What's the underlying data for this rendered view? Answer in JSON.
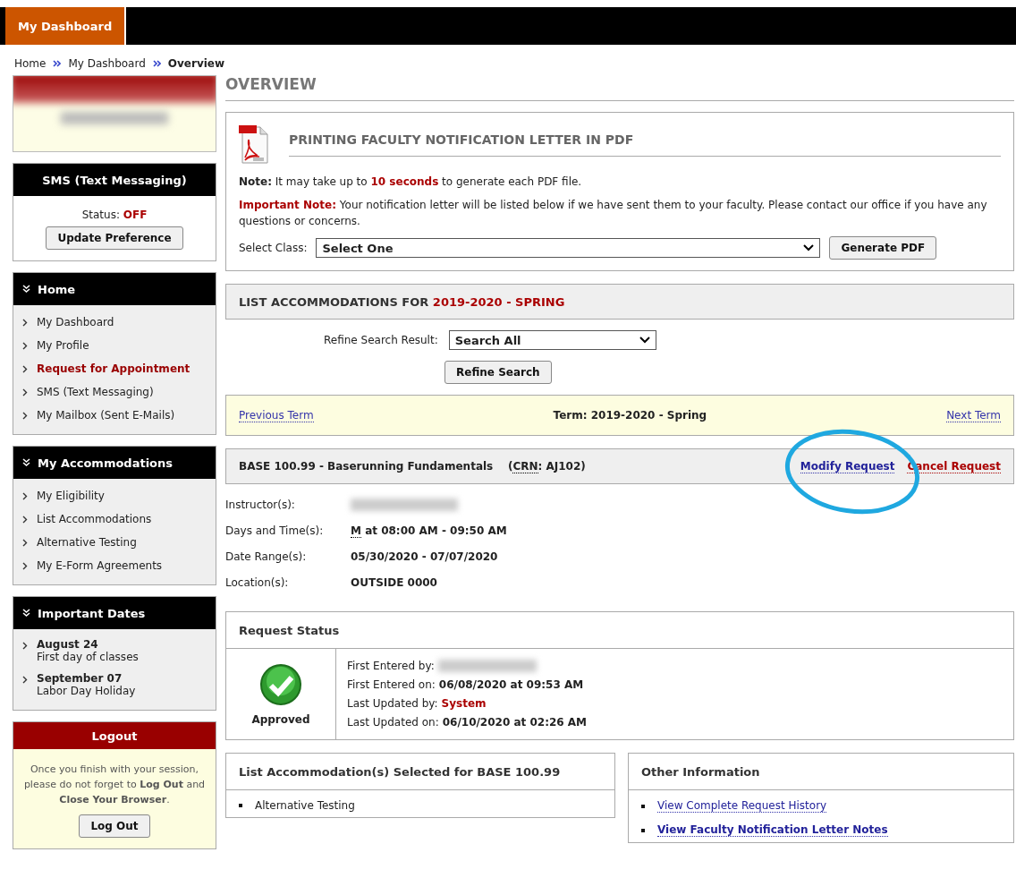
{
  "top_tabs": [
    {
      "label": "My Dashboard",
      "selected": true
    }
  ],
  "breadcrumb": [
    {
      "label": "Home",
      "current": false
    },
    {
      "label": "My Dashboard",
      "current": false
    },
    {
      "label": "Overview",
      "current": true
    }
  ],
  "sms_box": {
    "title": "SMS (Text Messaging)",
    "status_label": "Status:",
    "status_value": "OFF",
    "button": "Update Preference"
  },
  "nav_sections": [
    {
      "title": "Home",
      "items": [
        {
          "label": "My Dashboard",
          "selected": false
        },
        {
          "label": "My Profile",
          "selected": false
        },
        {
          "label": "Request for Appointment",
          "selected": true
        },
        {
          "label": "SMS (Text Messaging)",
          "selected": false
        },
        {
          "label": "My Mailbox (Sent E-Mails)",
          "selected": false
        }
      ]
    },
    {
      "title": "My Accommodations",
      "items": [
        {
          "label": "My Eligibility",
          "selected": false
        },
        {
          "label": "List Accommodations",
          "selected": false
        },
        {
          "label": "Alternative Testing",
          "selected": false
        },
        {
          "label": "My E-Form Agreements",
          "selected": false
        }
      ]
    }
  ],
  "important_dates": {
    "title": "Important Dates",
    "items": [
      {
        "date": "August 24",
        "event": "First day of classes"
      },
      {
        "date": "September 07",
        "event": "Labor Day Holiday"
      }
    ]
  },
  "logout_box": {
    "title": "Logout",
    "message": "Once you finish with your session, please do not forget to **Log Out** and **Close Your Browser**.",
    "button": "Log Out"
  },
  "page_title": "OVERVIEW",
  "pdf_panel": {
    "title": "PRINTING FACULTY NOTIFICATION LETTER IN PDF",
    "note": {
      "label": "Note:",
      "before": "It may take up to",
      "highlight": "10 seconds",
      "after": "to generate each PDF file."
    },
    "important_note": {
      "label": "Important Note:",
      "text": "Your notification letter will be listed below if we have sent them to your faculty. Please contact our office if you have any questions or concerns."
    },
    "select_label": "Select Class:",
    "select_value": "Select One",
    "button": "Generate PDF"
  },
  "accommodations": {
    "title": "LIST ACCOMMODATIONS FOR",
    "term": "2019-2020 - SPRING",
    "refine_label": "Refine Search Result:",
    "refine_value": "Search All",
    "refine_button": "Refine Search"
  },
  "term_bar": {
    "previous": "Previous Term",
    "term": "Term: 2019-2020 - Spring",
    "next": "Next Term"
  },
  "course": {
    "title": "BASE 100.99 - Baserunning Fundamentals",
    "crn_label": "CRN",
    "crn_value": ": AJ102)",
    "crn_open": "(",
    "modify": "Modify Request",
    "cancel": "Cancel Request"
  },
  "course_details": [
    {
      "label": "Instructor(s):",
      "kind": "blurred"
    },
    {
      "label": "Days and Time(s):",
      "kind": "abbr",
      "abbr": "M",
      "value": "at 08:00 AM - 09:50 AM"
    },
    {
      "label": "Date Range(s):",
      "kind": "text",
      "value": "05/30/2020 - 07/07/2020"
    },
    {
      "label": "Location(s):",
      "kind": "text",
      "value": "OUTSIDE 0000"
    }
  ],
  "request_status": {
    "title": "Request Status",
    "status": "Approved",
    "fields": [
      {
        "label": "First Entered by:",
        "kind": "blurred"
      },
      {
        "label": "First Entered on:",
        "kind": "bold",
        "value": "06/08/2020 at 09:53 AM"
      },
      {
        "label": "Last Updated by:",
        "kind": "highlight",
        "value": "System"
      },
      {
        "label": "Last Updated on:",
        "kind": "bold",
        "value": "06/10/2020 at 02:26 AM"
      }
    ]
  },
  "selected_accommodations": {
    "title": "List Accommodation(s) Selected for BASE 100.99",
    "items": [
      "Alternative Testing"
    ]
  },
  "other_information": {
    "title": "Other Information",
    "links": [
      {
        "label": "View Complete Request History",
        "bold": false
      },
      {
        "label": "View Faculty Notification Letter Notes",
        "bold": true
      }
    ]
  }
}
